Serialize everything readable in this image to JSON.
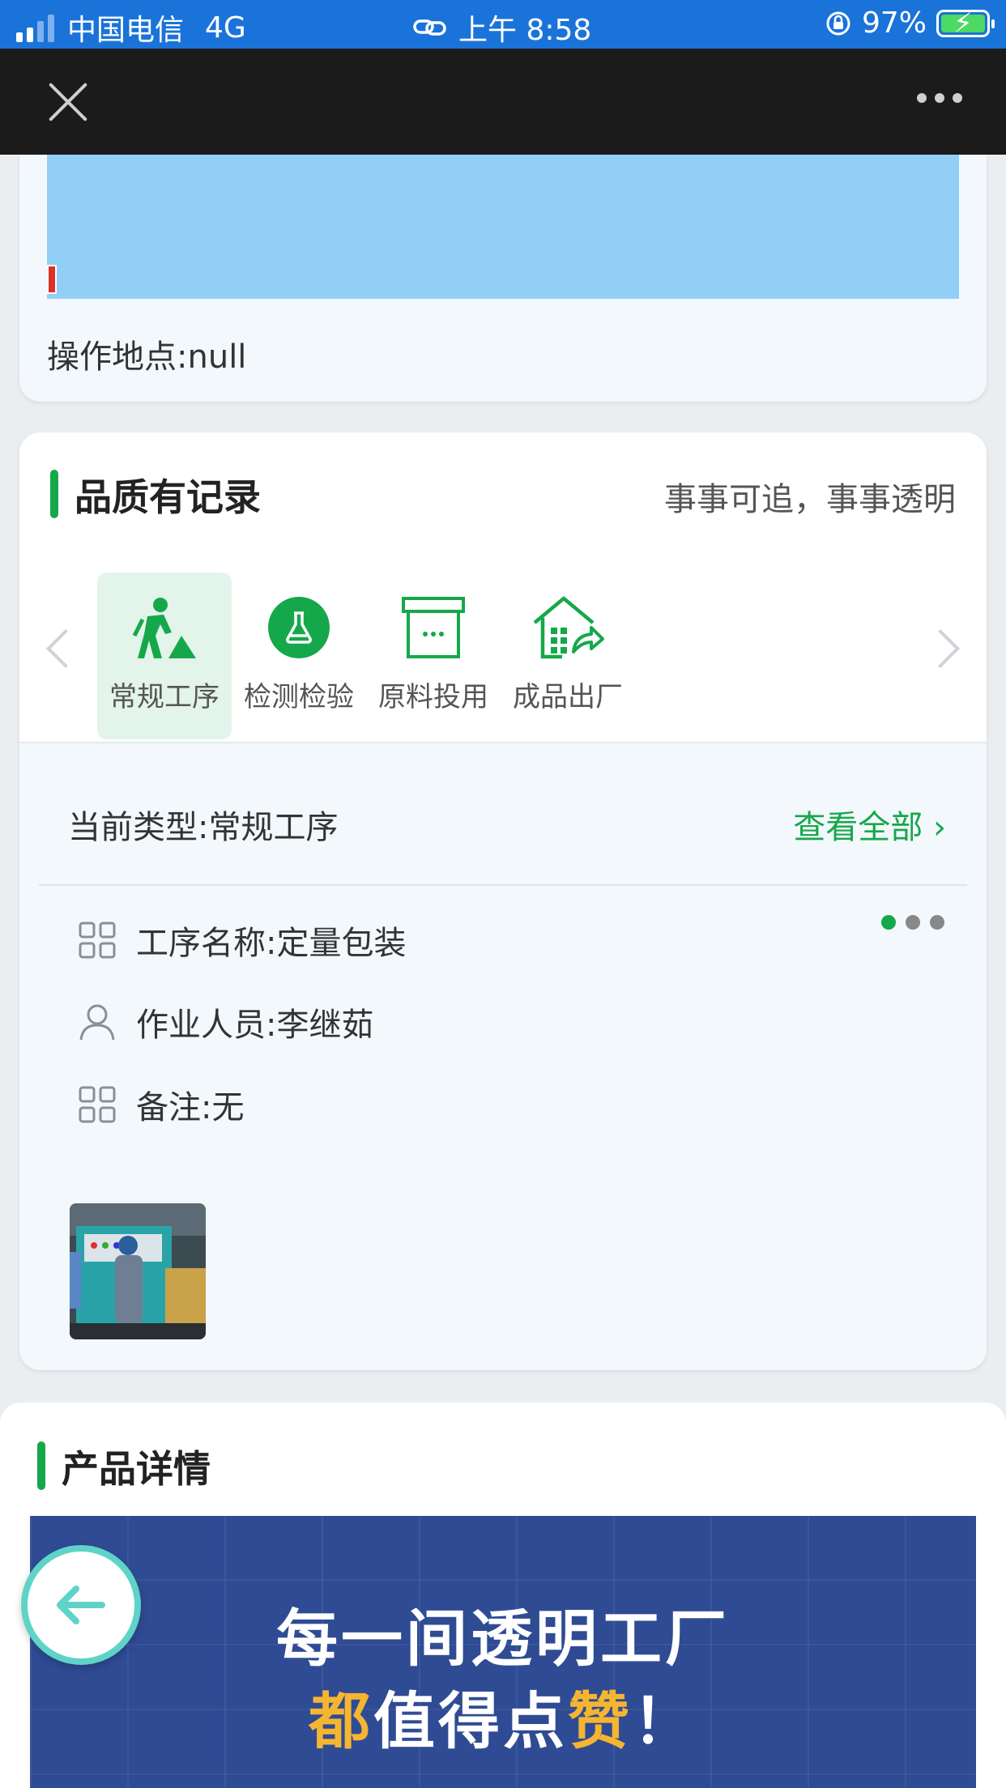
{
  "status_bar": {
    "carrier": "中国电信",
    "network": "4G",
    "time": "上午 8:58",
    "battery": "97%"
  },
  "prev_card": {
    "location_label": "操作地点:",
    "location_value": "null"
  },
  "quality": {
    "title": "品质有记录",
    "slogan": "事事可追，事事透明",
    "tabs": [
      {
        "label": "常规工序",
        "icon": "worker-icon",
        "active": true
      },
      {
        "label": "检测检验",
        "icon": "flask-icon",
        "active": false
      },
      {
        "label": "原料投用",
        "icon": "box-icon",
        "active": false
      },
      {
        "label": "成品出厂",
        "icon": "factory-share-icon",
        "active": false
      }
    ],
    "current_type_label": "当前类型:",
    "current_type_value": "常规工序",
    "view_all": "查看全部 ›",
    "pager": {
      "pages": 3,
      "current": 1
    },
    "fields": [
      {
        "label": "工序名称:",
        "value": "定量包装",
        "icon": "grid-icon"
      },
      {
        "label": "作业人员:",
        "value": "李继茹",
        "icon": "person-icon"
      },
      {
        "label": "备注:",
        "value": "无",
        "icon": "grid-icon"
      }
    ]
  },
  "product": {
    "title": "产品详情",
    "banner_line1": "每一间透明工厂",
    "banner_line2_hl1": "都",
    "banner_line2_mid": "值得点",
    "banner_line2_hl2": "赞",
    "banner_line2_end": "！"
  },
  "colors": {
    "accent_green": "#15a84a",
    "status_blue": "#1a73d9",
    "nav_dark": "#1b1b1b",
    "banner_blue": "#2f4b94",
    "banner_highlight": "#f6b531"
  }
}
